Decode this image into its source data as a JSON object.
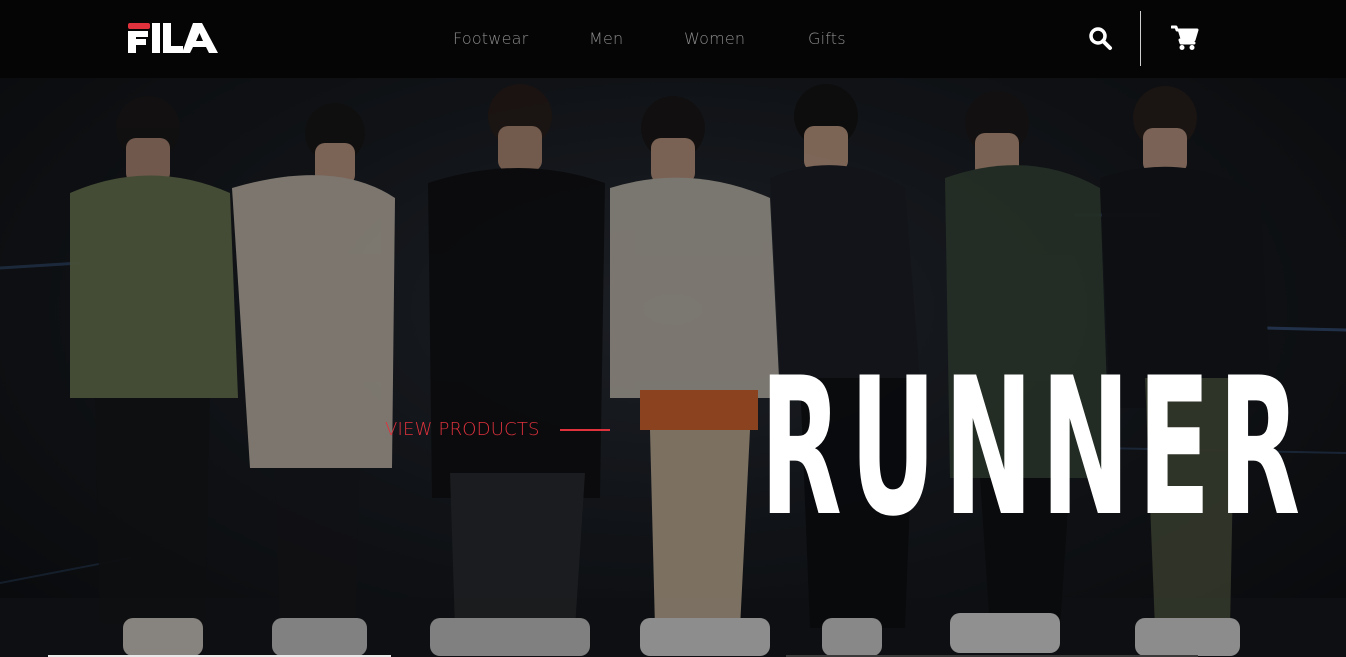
{
  "header": {
    "logo_text": "FILA",
    "nav": [
      {
        "label": "Footwear"
      },
      {
        "label": "Men"
      },
      {
        "label": "Women"
      },
      {
        "label": "Gifts"
      }
    ],
    "search_icon": "search-icon",
    "cart_icon": "cart-icon"
  },
  "hero": {
    "title": "RUNNER",
    "cta_label": "VIEW PRODUCTS"
  },
  "colors": {
    "header_bg": "#050505",
    "accent": "#e0323d",
    "brand_red": "#e0323d",
    "nav_text": "#8c8c8c",
    "title_text": "#ffffff"
  }
}
